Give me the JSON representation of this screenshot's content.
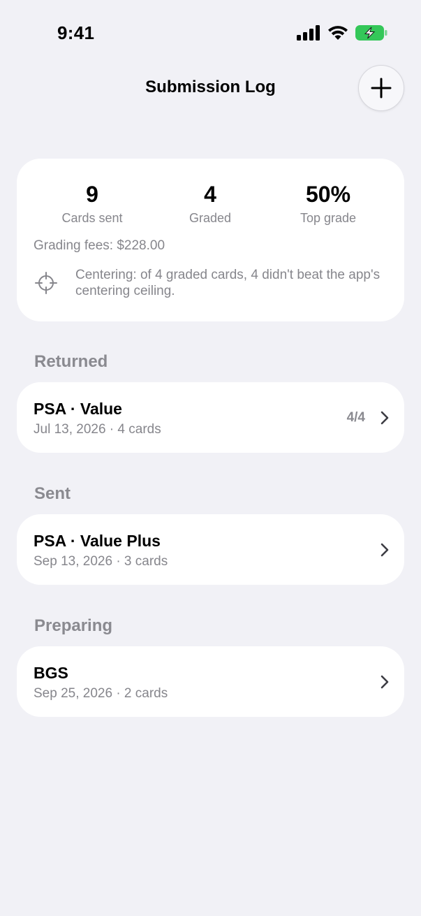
{
  "status_bar": {
    "time": "9:41"
  },
  "nav": {
    "title": "Submission Log",
    "add_icon": "plus-icon"
  },
  "summary": {
    "stats": [
      {
        "value": "9",
        "label": "Cards sent"
      },
      {
        "value": "4",
        "label": "Graded"
      },
      {
        "value": "50%",
        "label": "Top grade"
      }
    ],
    "fees": "Grading fees: $228.00",
    "centering_icon": "crosshair-icon",
    "centering_text": "Centering: of 4 graded cards, 4 didn't beat the app's centering ceiling."
  },
  "sections": [
    {
      "title": "Returned",
      "rows": [
        {
          "title": "PSA · Value",
          "subtitle": "Jul 13, 2026 · 4 cards",
          "count": "4/4"
        }
      ]
    },
    {
      "title": "Sent",
      "rows": [
        {
          "title": "PSA · Value Plus",
          "subtitle": "Sep 13, 2026 · 3 cards"
        }
      ]
    },
    {
      "title": "Preparing",
      "rows": [
        {
          "title": "BGS",
          "subtitle": "Sep 25, 2026 · 2 cards"
        }
      ]
    }
  ],
  "colors": {
    "background": "#f1f1f6",
    "card": "#ffffff",
    "secondary_text": "#86868c",
    "battery": "#34c759"
  }
}
